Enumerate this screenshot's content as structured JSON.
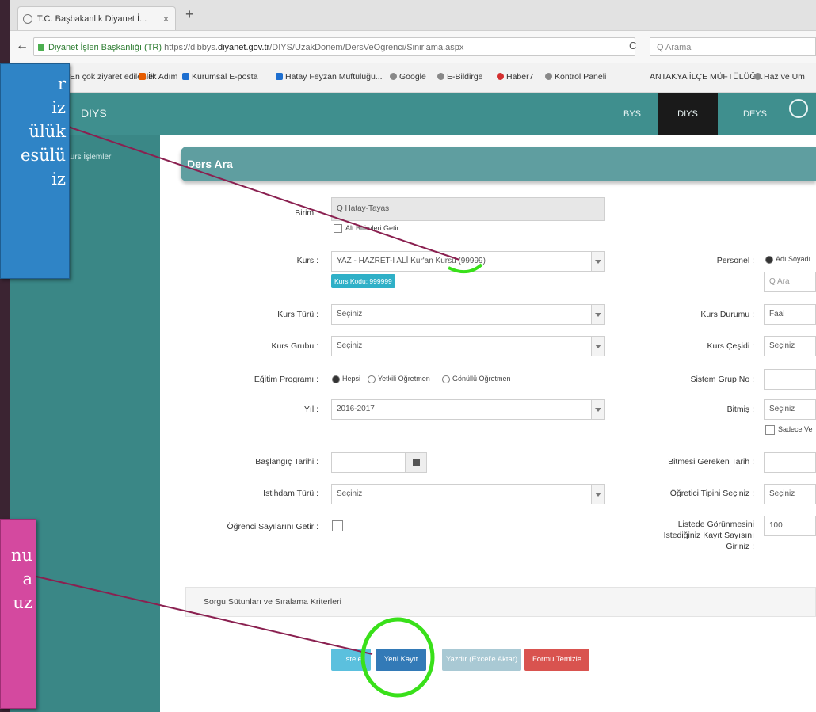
{
  "browser": {
    "tab_title": "T.C. Başbakanlık Diyanet İ...",
    "tab_close": "×",
    "new_tab": "+",
    "back": "←",
    "url_site": "Diyanet İşleri Başkanlığı (TR)",
    "url_prefix": "https://dibbys.",
    "url_domain": "diyanet.gov.tr",
    "url_path": "/DIYS/UzakDonem/DersVeOgrenci/Sinirlama.aspx",
    "reload": "C",
    "search_placeholder": "Q Arama",
    "bookmarks": [
      "En çok ziyaret edilenler",
      "İlk Adım",
      "Kurumsal E-posta",
      "Hatay Feyzan Müftülüğü...",
      "Google",
      "E-Bildirge",
      "Haber7",
      "Kontrol Paneli",
      "ANTAKYA İLÇE MÜFTÜLÜĞ...",
      "Haz ve Um"
    ]
  },
  "app": {
    "brand": "DIYS",
    "nav": [
      "BYS",
      "DIYS",
      "DEYS"
    ],
    "sidebar_item": "Kurs İşlemleri"
  },
  "panel": {
    "title": "Ders Ara",
    "mufti_label": "Birim :",
    "mufti_value": "Q  Hatay-Tayas",
    "alt_units_label": "Alt Birimleri Getir",
    "kurs_label": "Kurs :",
    "kurs_value": "YAZ - HAZRET-I ALİ Kur'an Kursu (99999)",
    "kurs_chip": "Kurs Kodu: 999999",
    "kurs_turu_label": "Kurs Türü :",
    "kurs_grubu_label": "Kurs Grubu :",
    "secin": "Seçiniz",
    "egitim_label": "Eğitim Programı :",
    "egitim_options": [
      "Hepsi",
      "Yetkili Öğretmen",
      "Gönüllü Öğretmen"
    ],
    "yil_label": "Yıl :",
    "yil_value": "2016-2017",
    "baslangic_label": "Başlangıç Tarihi :",
    "istihdam_label": "İstihdam Türü :",
    "ogrenci_sayisi_label": "Öğrenci Sayılarını Getir :",
    "personel_label": "Personel :",
    "personel_option": "Adı Soyadı",
    "personel_search": "Q Ara",
    "kurs_durumu_label": "Kurs Durumu :",
    "kurs_durumu_value": "Faal",
    "kurs_cesidi_label": "Kurs Çeşidi :",
    "sistem_grup_label": "Sistem Grup No :",
    "bitmis_label": "Bitmiş :",
    "sadece_label": "Sadece Ve",
    "bitmesi_label": "Bitmesi Gereken Tarih :",
    "ogretici_label": "Öğretici Tipini Seçiniz :",
    "listede_label_lines": [
      "Listede Görünmesini",
      "İstediğiniz Kayıt Sayısını",
      "Giriniz :"
    ],
    "listede_value": "100",
    "criteria_label": "Sorgu Sütunları ve Sıralama Kriterleri",
    "buttons": [
      "Listele",
      "Yeni Kayıt",
      "Yazdır (Excel'e Aktar)",
      "Formu Temizle"
    ]
  },
  "callouts": {
    "blue_lines": [
      "r",
      "iz",
      "ülük",
      "esülü",
      "iz"
    ],
    "pink_lines": [
      "nu",
      "a",
      "uz"
    ]
  },
  "colors": {
    "header_teal": "#3f8f8e",
    "panel_teal": "#5f9ea0",
    "btn_listele": "#5bc0de",
    "btn_yeni": "#337ab7",
    "btn_yazdir": "#a9c9d4",
    "btn_temizle": "#d9534f",
    "highlight_green": "#39e01a",
    "callout_blue": "#2f84c6",
    "callout_pink": "#d4499f"
  }
}
